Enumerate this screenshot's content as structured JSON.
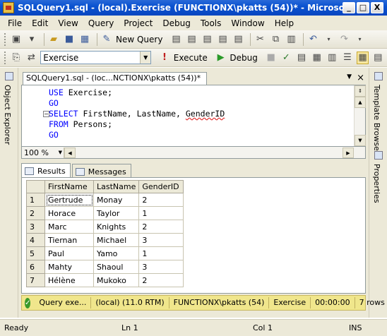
{
  "window": {
    "title": "SQLQuery1.sql - (local).Exercise (FUNCTIONX\\pkatts (54))* - Microsoft SQL Serve...",
    "minimize": "_",
    "maximize": "□",
    "close": "X"
  },
  "menu": [
    "File",
    "Edit",
    "View",
    "Query",
    "Project",
    "Debug",
    "Tools",
    "Window",
    "Help"
  ],
  "toolbar": {
    "new_query": "New Query",
    "database": "Exercise",
    "execute": "Execute",
    "debug": "Debug"
  },
  "left_panel": {
    "object_explorer": "Object Explorer"
  },
  "right_panel": {
    "template_browser": "Template Browser",
    "properties": "Properties"
  },
  "document": {
    "tab_title": "SQLQuery1.sql - (loc...NCTIONX\\pkatts (54))*",
    "zoom": "100 %",
    "code": {
      "line1_kw": "USE",
      "line1_rest": " Exercise;",
      "line2": "GO",
      "line3_kw": "SELECT",
      "line3_cols": " FirstName, LastName, ",
      "line3_last": "GenderID",
      "line4_kw": "FROM",
      "line4_rest": " Persons;",
      "line5": "GO"
    }
  },
  "results": {
    "tabs": [
      "Results",
      "Messages"
    ],
    "columns": [
      "FirstName",
      "LastName",
      "GenderID"
    ],
    "rows": [
      {
        "n": "1",
        "first": "Gertrude",
        "last": "Monay",
        "gender": "2"
      },
      {
        "n": "2",
        "first": "Horace",
        "last": "Taylor",
        "gender": "1"
      },
      {
        "n": "3",
        "first": "Marc",
        "last": "Knights",
        "gender": "2"
      },
      {
        "n": "4",
        "first": "Tiernan",
        "last": "Michael",
        "gender": "3"
      },
      {
        "n": "5",
        "first": "Paul",
        "last": "Yamo",
        "gender": "1"
      },
      {
        "n": "6",
        "first": "Mahty",
        "last": "Shaoul",
        "gender": "3"
      },
      {
        "n": "7",
        "first": "Hélène",
        "last": "Mukoko",
        "gender": "2"
      }
    ]
  },
  "query_status": {
    "message": "Query exe...",
    "server": "(local) (11.0 RTM)",
    "user": "FUNCTIONX\\pkatts (54)",
    "database": "Exercise",
    "time": "00:00:00",
    "rows": "7 rows"
  },
  "statusbar": {
    "ready": "Ready",
    "line": "Ln 1",
    "col": "Col 1",
    "ins": "INS"
  }
}
